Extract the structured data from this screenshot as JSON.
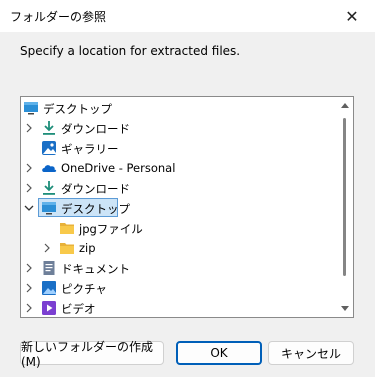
{
  "window": {
    "title": "フォルダーの参照",
    "close_glyph": "✕"
  },
  "description": "Specify a location for extracted files.",
  "tree": {
    "items": [
      {
        "label": "デスクトップ",
        "icon": "desktop-icon",
        "expander": "none"
      },
      {
        "label": "ダウンロード",
        "icon": "download-icon",
        "expander": "collapsed"
      },
      {
        "label": "ギャラリー",
        "icon": "gallery-icon",
        "expander": "none"
      },
      {
        "label": "OneDrive - Personal",
        "icon": "onedrive-icon",
        "expander": "collapsed"
      },
      {
        "label": "ダウンロード",
        "icon": "download-icon",
        "expander": "collapsed"
      },
      {
        "label": "デスクトップ",
        "icon": "desktop-icon",
        "expander": "expanded",
        "selected": true
      },
      {
        "label": "jpgファイル",
        "icon": "folder-icon",
        "expander": "none"
      },
      {
        "label": "zip",
        "icon": "folder-icon",
        "expander": "collapsed"
      },
      {
        "label": "ドキュメント",
        "icon": "documents-icon",
        "expander": "collapsed"
      },
      {
        "label": "ピクチャ",
        "icon": "pictures-icon",
        "expander": "collapsed"
      },
      {
        "label": "ビデオ",
        "icon": "videos-icon",
        "expander": "collapsed"
      }
    ]
  },
  "buttons": {
    "new_folder": "新しいフォルダーの作成(M)",
    "ok": "OK",
    "cancel": "キャンセル"
  },
  "colors": {
    "accent": "#005fb8",
    "selection_bg": "#cce4f7",
    "folder": "#f8c94a",
    "download": "#1e8e7a",
    "onedrive": "#0a64c8"
  }
}
